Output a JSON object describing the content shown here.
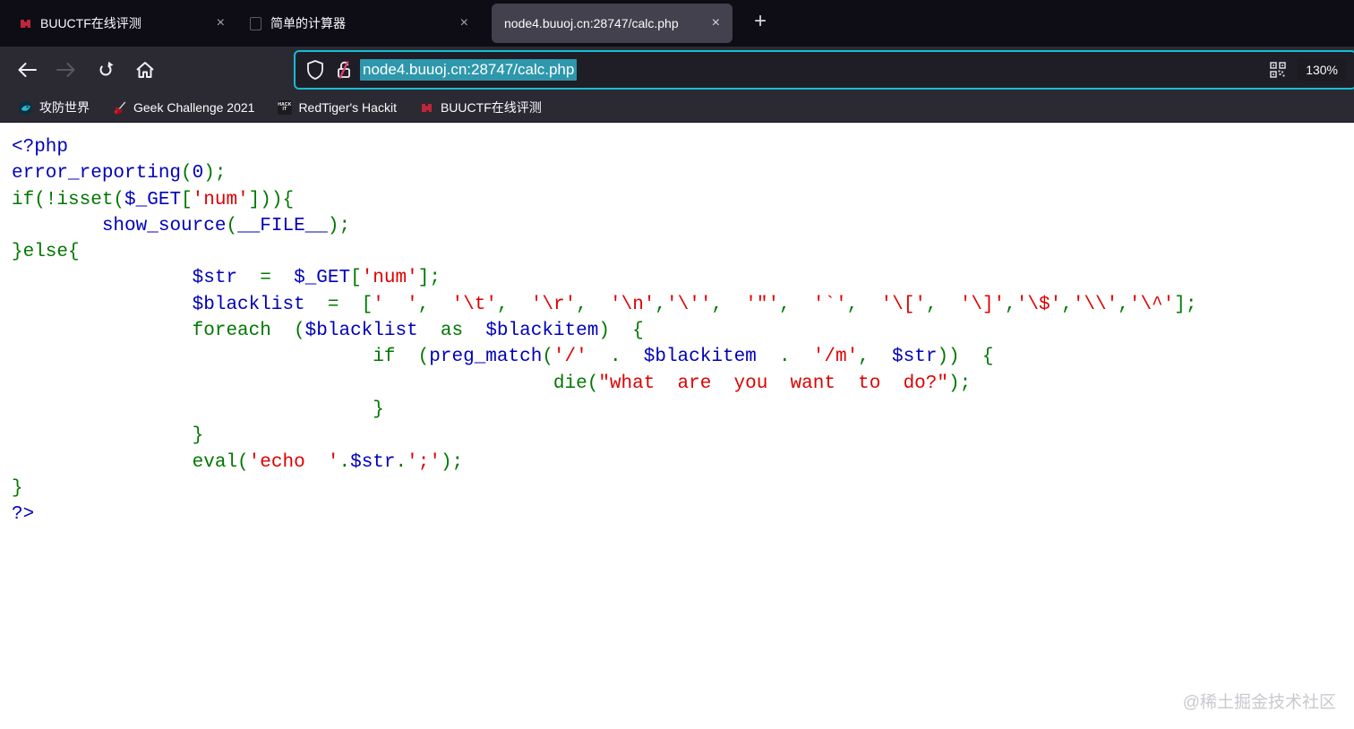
{
  "window": {
    "tabs": [
      {
        "title": "BUUCTF在线评测",
        "active": false
      },
      {
        "title": "简单的计算器",
        "active": false
      },
      {
        "title": "node4.buuoj.cn:28747/calc.php",
        "active": true
      }
    ],
    "close_glyph": "×",
    "new_tab_glyph": "+"
  },
  "toolbar": {
    "url": "node4.buuoj.cn:28747/calc.php",
    "url_selected": true,
    "zoom_level": "130%",
    "accent_color": "#15bdd3",
    "selection_color": "#2e97ab"
  },
  "bookmarks": {
    "items": [
      {
        "label": "攻防世界"
      },
      {
        "label": "Geek Challenge 2021"
      },
      {
        "label": "RedTiger's Hackit",
        "badge_line1": "HACK",
        "badge_line2": "IT"
      },
      {
        "label": "BUUCTF在线评测"
      }
    ]
  },
  "page": {
    "watermark": "@稀土掘金技术社区",
    "syntax_colors": {
      "default": "#0000BB",
      "keyword": "#007700",
      "string": "#DD0000"
    },
    "code_lines": [
      [
        {
          "t": "<?php",
          "c": "b"
        }
      ],
      [
        {
          "t": "error_reporting",
          "c": "b"
        },
        {
          "t": "(",
          "c": "g"
        },
        {
          "t": "0",
          "c": "b"
        },
        {
          "t": ");",
          "c": "g"
        }
      ],
      [
        {
          "t": "if(!isset(",
          "c": "g"
        },
        {
          "t": "$_GET",
          "c": "b"
        },
        {
          "t": "[",
          "c": "g"
        },
        {
          "t": "'num'",
          "c": "r"
        },
        {
          "t": "])){",
          "c": "g"
        }
      ],
      [
        {
          "t": "        ",
          "c": "g"
        },
        {
          "t": "show_source",
          "c": "b"
        },
        {
          "t": "(",
          "c": "g"
        },
        {
          "t": "__FILE__",
          "c": "b"
        },
        {
          "t": ");",
          "c": "g"
        }
      ],
      [
        {
          "t": "}else{",
          "c": "g"
        }
      ],
      [
        {
          "t": "                ",
          "c": "g"
        },
        {
          "t": "$str",
          "c": "b"
        },
        {
          "t": "  =  ",
          "c": "g"
        },
        {
          "t": "$_GET",
          "c": "b"
        },
        {
          "t": "[",
          "c": "g"
        },
        {
          "t": "'num'",
          "c": "r"
        },
        {
          "t": "];",
          "c": "g"
        }
      ],
      [
        {
          "t": "                ",
          "c": "g"
        },
        {
          "t": "$blacklist",
          "c": "b"
        },
        {
          "t": "  =  [",
          "c": "g"
        },
        {
          "t": "'  '",
          "c": "r"
        },
        {
          "t": ",  ",
          "c": "g"
        },
        {
          "t": "'\\t'",
          "c": "r"
        },
        {
          "t": ",  ",
          "c": "g"
        },
        {
          "t": "'\\r'",
          "c": "r"
        },
        {
          "t": ",  ",
          "c": "g"
        },
        {
          "t": "'\\n'",
          "c": "r"
        },
        {
          "t": ",",
          "c": "g"
        },
        {
          "t": "'\\''",
          "c": "r"
        },
        {
          "t": ",  ",
          "c": "g"
        },
        {
          "t": "'\"'",
          "c": "r"
        },
        {
          "t": ",  ",
          "c": "g"
        },
        {
          "t": "'`'",
          "c": "r"
        },
        {
          "t": ",  ",
          "c": "g"
        },
        {
          "t": "'\\['",
          "c": "r"
        },
        {
          "t": ",  ",
          "c": "g"
        },
        {
          "t": "'\\]'",
          "c": "r"
        },
        {
          "t": ",",
          "c": "g"
        },
        {
          "t": "'\\$'",
          "c": "r"
        },
        {
          "t": ",",
          "c": "g"
        },
        {
          "t": "'\\\\'",
          "c": "r"
        },
        {
          "t": ",",
          "c": "g"
        },
        {
          "t": "'\\^'",
          "c": "r"
        },
        {
          "t": "];",
          "c": "g"
        }
      ],
      [
        {
          "t": "                foreach  (",
          "c": "g"
        },
        {
          "t": "$blacklist",
          "c": "b"
        },
        {
          "t": "  as  ",
          "c": "g"
        },
        {
          "t": "$blackitem",
          "c": "b"
        },
        {
          "t": ")  {",
          "c": "g"
        }
      ],
      [
        {
          "t": "                                if  (",
          "c": "g"
        },
        {
          "t": "preg_match",
          "c": "b"
        },
        {
          "t": "(",
          "c": "g"
        },
        {
          "t": "'/'",
          "c": "r"
        },
        {
          "t": "  .  ",
          "c": "g"
        },
        {
          "t": "$blackitem",
          "c": "b"
        },
        {
          "t": "  .  ",
          "c": "g"
        },
        {
          "t": "'/m'",
          "c": "r"
        },
        {
          "t": ",  ",
          "c": "g"
        },
        {
          "t": "$str",
          "c": "b"
        },
        {
          "t": "))  {",
          "c": "g"
        }
      ],
      [
        {
          "t": "                                                die(",
          "c": "g"
        },
        {
          "t": "\"what  are  you  want  to  do?\"",
          "c": "r"
        },
        {
          "t": ");",
          "c": "g"
        }
      ],
      [
        {
          "t": "                                }",
          "c": "g"
        }
      ],
      [
        {
          "t": "                }",
          "c": "g"
        }
      ],
      [
        {
          "t": "                eval(",
          "c": "g"
        },
        {
          "t": "'echo  '",
          "c": "r"
        },
        {
          "t": ".",
          "c": "g"
        },
        {
          "t": "$str",
          "c": "b"
        },
        {
          "t": ".",
          "c": "g"
        },
        {
          "t": "';'",
          "c": "r"
        },
        {
          "t": ");",
          "c": "g"
        }
      ],
      [
        {
          "t": "}",
          "c": "g"
        }
      ],
      [
        {
          "t": "?>",
          "c": "b"
        }
      ]
    ]
  }
}
